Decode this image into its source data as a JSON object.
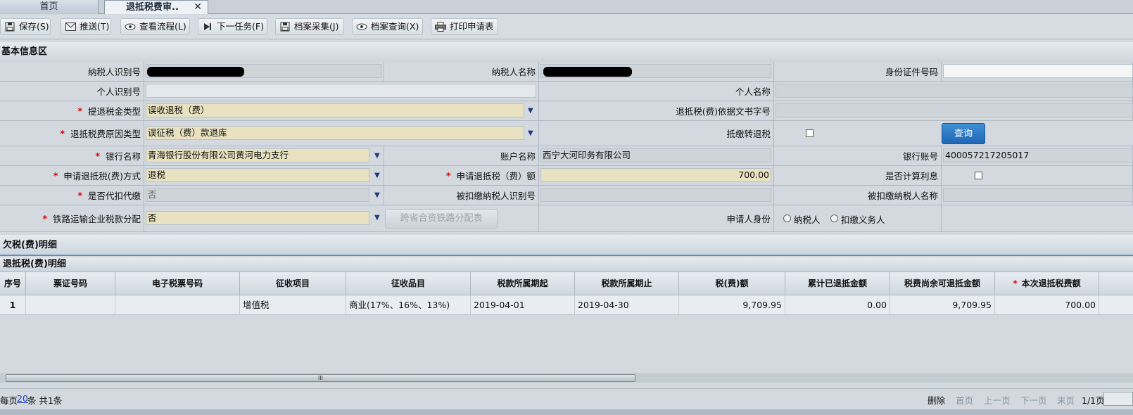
{
  "tabs": {
    "home": "首页",
    "active": "退抵税费审..",
    "close": "✕"
  },
  "toolbar": {
    "save": "保存(S)",
    "push": "推送(T)",
    "view_flow": "查看流程(L)",
    "next_task": "下一任务(F)",
    "archive_collect": "档案采集(J)",
    "archive_query": "档案查询(X)",
    "print_form": "打印申请表"
  },
  "sections": {
    "basic": "基本信息区",
    "arrears": "欠税(费)明细",
    "refund": "退抵税(费)明细"
  },
  "form": {
    "taxpayer_id_label": "纳税人识别号",
    "taxpayer_name_label": "纳税人名称",
    "id_doc_label": "身份证件号码",
    "personal_id_label": "个人识别号",
    "personal_name_label": "个人名称",
    "refund_type_label": "提退税金类型",
    "refund_type_value": "误收退税（费）",
    "doc_no_label": "退抵税(费)依据文书字号",
    "reason_type_label": "退抵税费原因类型",
    "reason_type_value": "误征税（费）款退库",
    "offset_label": "抵缴转退税",
    "query_button": "查询",
    "bank_name_label": "银行名称",
    "bank_name_value": "青海银行股份有限公司黄河电力支行",
    "account_name_label": "账户名称",
    "account_name_value": "西宁大河印务有限公司",
    "bank_account_label": "银行账号",
    "bank_account_value": "400057217205017",
    "method_label": "申请退抵税(费)方式",
    "method_value": "退税",
    "amount_label": "申请退抵税（费）额",
    "amount_value": "700.00",
    "interest_label": "是否计算利息",
    "withhold_label": "是否代扣代缴",
    "withhold_value": "否",
    "withheld_id_label": "被扣缴纳税人识别号",
    "withheld_name_label": "被扣缴纳税人名称",
    "railway_label": "铁路运输企业税款分配",
    "railway_value": "否",
    "railway_table_button": "跨省合资铁路分配表",
    "applicant_label": "申请人身份",
    "applicant_opt1": "纳税人",
    "applicant_opt2": "扣缴义务人"
  },
  "grid": {
    "columns": [
      "序号",
      "票证号码",
      "电子税票号码",
      "征收项目",
      "征收品目",
      "税款所属期起",
      "税款所属期止",
      "税(费)额",
      "累计已退抵金额",
      "税费尚余可退抵金额",
      "本次退抵税费额"
    ],
    "rows": [
      [
        "1",
        "",
        "",
        "增值税",
        "商业(17%、16%、13%)",
        "2019-04-01",
        "2019-04-30",
        "9,709.95",
        "0.00",
        "9,709.95",
        "700.00"
      ]
    ]
  },
  "pager": {
    "per_page_prefix": "每页",
    "per_page": "20",
    "total": "条 共1条",
    "delete": "删除",
    "first": "首页",
    "prev": "上一页",
    "next": "下一页",
    "last": "末页",
    "page_info": "1/1页"
  },
  "scroll_glyph": "III"
}
